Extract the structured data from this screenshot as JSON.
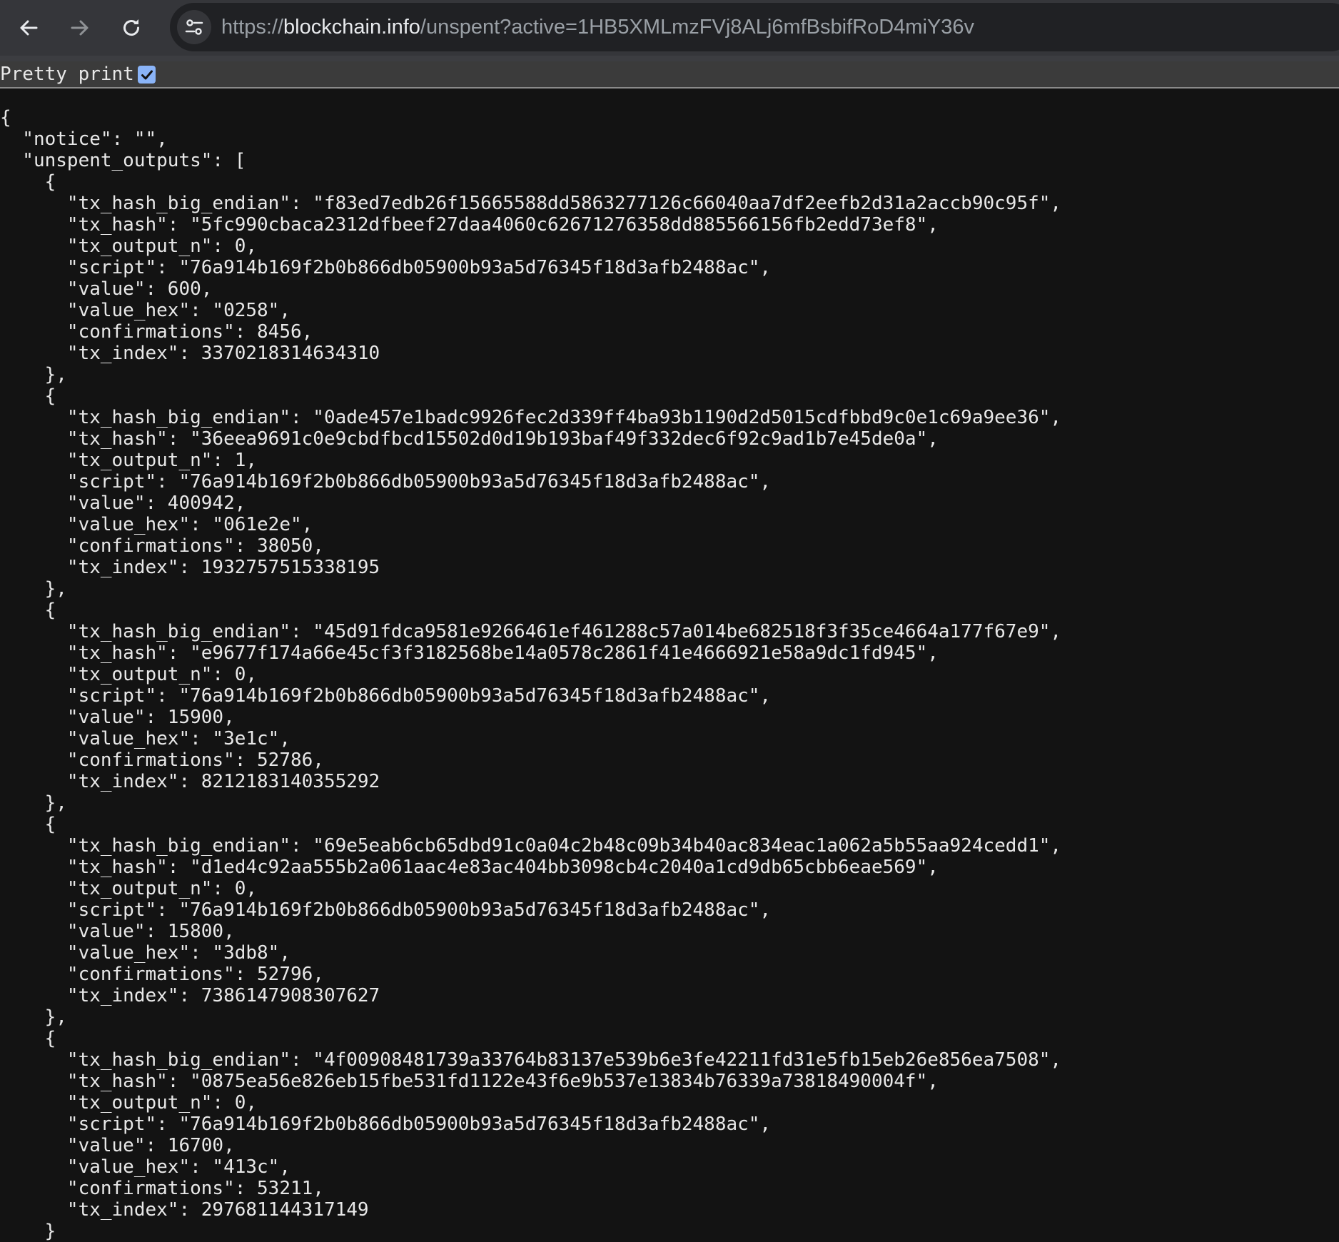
{
  "browser": {
    "url_scheme": "https://",
    "url_host": "blockchain.info",
    "url_path": "/unspent?active=1HB5XMLmzFVj8ALj6mfBsbifRoD4miY36v"
  },
  "pretty_print": {
    "label": "Pretty print",
    "checked": true
  },
  "json_lines": [
    "{",
    "  \"notice\": \"\",",
    "  \"unspent_outputs\": [",
    "    {",
    "      \"tx_hash_big_endian\": \"f83ed7edb26f15665588dd5863277126c66040aa7df2eefb2d31a2accb90c95f\",",
    "      \"tx_hash\": \"5fc990cbaca2312dfbeef27daa4060c62671276358dd885566156fb2edd73ef8\",",
    "      \"tx_output_n\": 0,",
    "      \"script\": \"76a914b169f2b0b866db05900b93a5d76345f18d3afb2488ac\",",
    "      \"value\": 600,",
    "      \"value_hex\": \"0258\",",
    "      \"confirmations\": 8456,",
    "      \"tx_index\": 3370218314634310",
    "    },",
    "    {",
    "      \"tx_hash_big_endian\": \"0ade457e1badc9926fec2d339ff4ba93b1190d2d5015cdfbbd9c0e1c69a9ee36\",",
    "      \"tx_hash\": \"36eea9691c0e9cbdfbcd15502d0d19b193baf49f332dec6f92c9ad1b7e45de0a\",",
    "      \"tx_output_n\": 1,",
    "      \"script\": \"76a914b169f2b0b866db05900b93a5d76345f18d3afb2488ac\",",
    "      \"value\": 400942,",
    "      \"value_hex\": \"061e2e\",",
    "      \"confirmations\": 38050,",
    "      \"tx_index\": 1932757515338195",
    "    },",
    "    {",
    "      \"tx_hash_big_endian\": \"45d91fdca9581e9266461ef461288c57a014be682518f3f35ce4664a177f67e9\",",
    "      \"tx_hash\": \"e9677f174a66e45cf3f3182568be14a0578c2861f41e4666921e58a9dc1fd945\",",
    "      \"tx_output_n\": 0,",
    "      \"script\": \"76a914b169f2b0b866db05900b93a5d76345f18d3afb2488ac\",",
    "      \"value\": 15900,",
    "      \"value_hex\": \"3e1c\",",
    "      \"confirmations\": 52786,",
    "      \"tx_index\": 8212183140355292",
    "    },",
    "    {",
    "      \"tx_hash_big_endian\": \"69e5eab6cb65dbd91c0a04c2b48c09b34b40ac834eac1a062a5b55aa924cedd1\",",
    "      \"tx_hash\": \"d1ed4c92aa555b2a061aac4e83ac404bb3098cb4c2040a1cd9db65cbb6eae569\",",
    "      \"tx_output_n\": 0,",
    "      \"script\": \"76a914b169f2b0b866db05900b93a5d76345f18d3afb2488ac\",",
    "      \"value\": 15800,",
    "      \"value_hex\": \"3db8\",",
    "      \"confirmations\": 52796,",
    "      \"tx_index\": 7386147908307627",
    "    },",
    "    {",
    "      \"tx_hash_big_endian\": \"4f00908481739a33764b83137e539b6e3fe42211fd31e5fb15eb26e856ea7508\",",
    "      \"tx_hash\": \"0875ea56e826eb15fbe531fd1122e43f6e9b537e13834b76339a73818490004f\",",
    "      \"tx_output_n\": 0,",
    "      \"script\": \"76a914b169f2b0b866db05900b93a5d76345f18d3afb2488ac\",",
    "      \"value\": 16700,",
    "      \"value_hex\": \"413c\",",
    "      \"confirmations\": 53211,",
    "      \"tx_index\": 297681144317149",
    "    }"
  ]
}
